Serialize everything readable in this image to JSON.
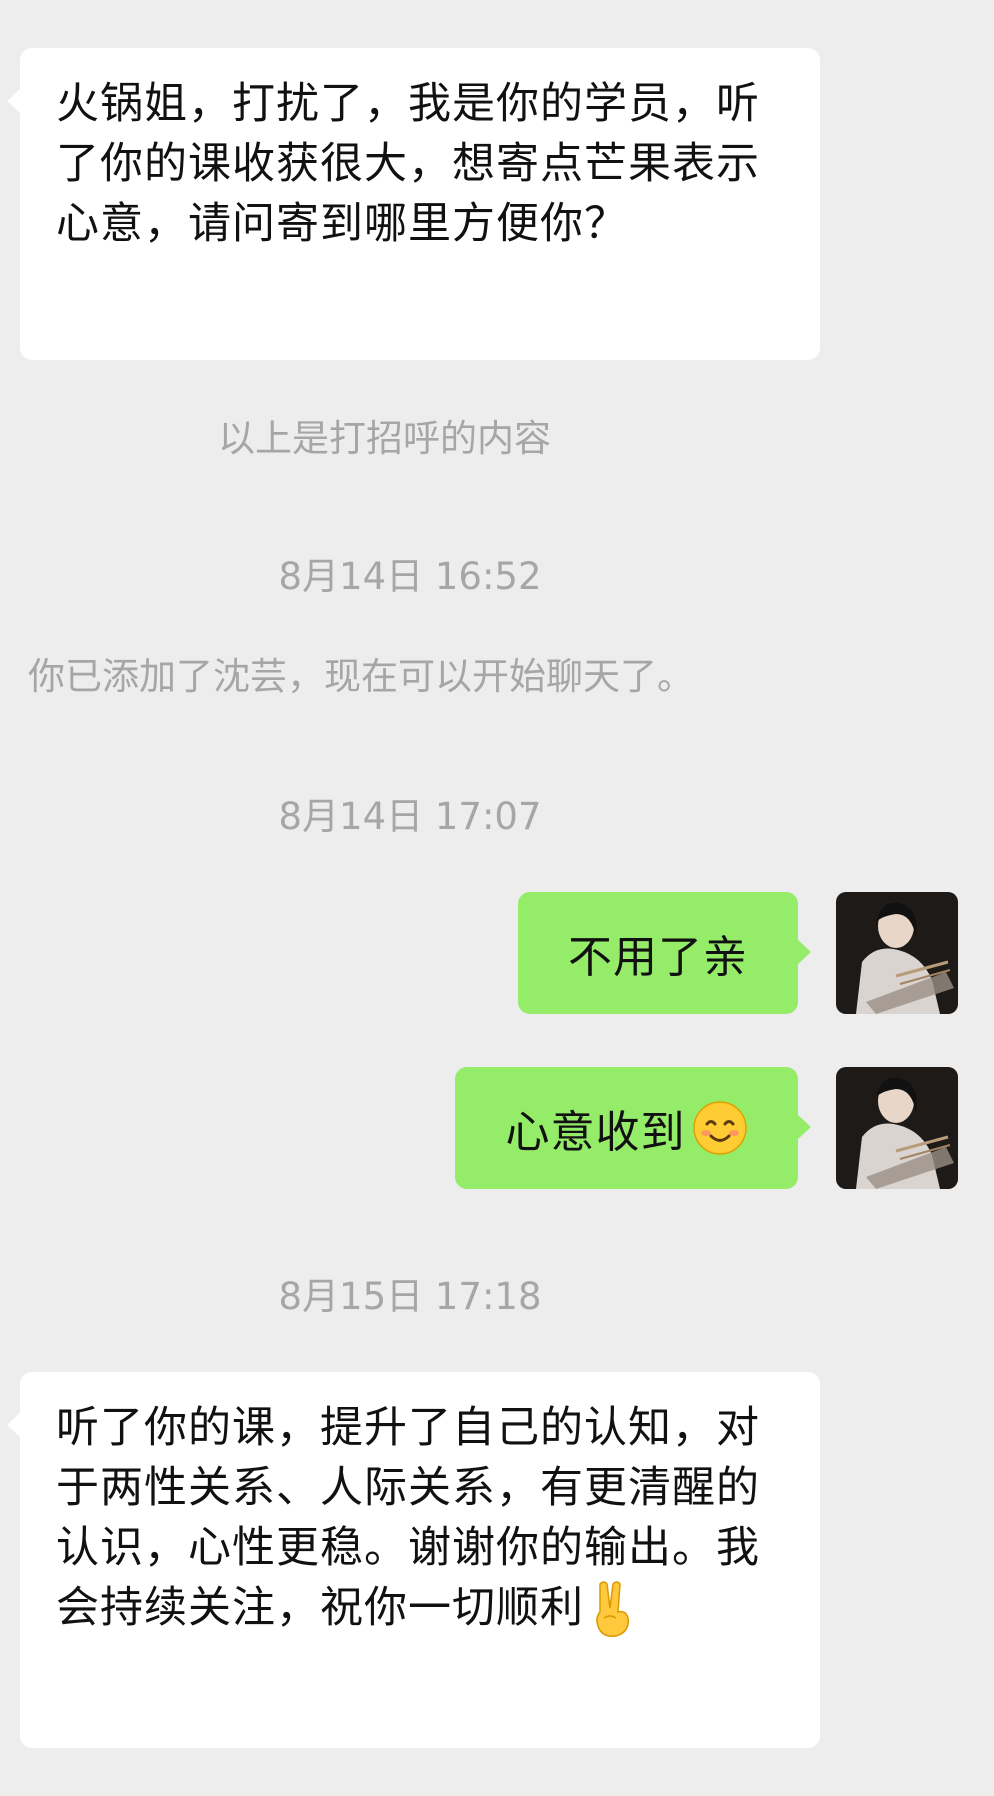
{
  "messages": {
    "msg1": "火锅姐，打扰了，我是你的学员，听了你的课收获很大，想寄点芒果表示心意，请问寄到哪里方便你？",
    "greeting_note": "以上是打招呼的内容",
    "time1": "8月14日 16:52",
    "added_notice": "你已添加了沈芸，现在可以开始聊天了。",
    "time2": "8月14日 17:07",
    "reply1": "不用了亲",
    "reply2": "心意收到",
    "time3": "8月15日 17:18",
    "msg2": "听了你的课，提升了自己的认知，对于两性关系、人际关系，有更清醒的认识，心性更稳。谢谢你的输出。我会持续关注，祝你一切顺利"
  },
  "icons": {
    "reply2_emoji": "smiling-face-icon",
    "msg2_emoji": "victory-hand-icon",
    "avatar": "user-avatar"
  },
  "colors": {
    "background": "#ededed",
    "incoming_bubble": "#ffffff",
    "outgoing_bubble": "#95ec69",
    "system_text": "#a6a6a6"
  }
}
